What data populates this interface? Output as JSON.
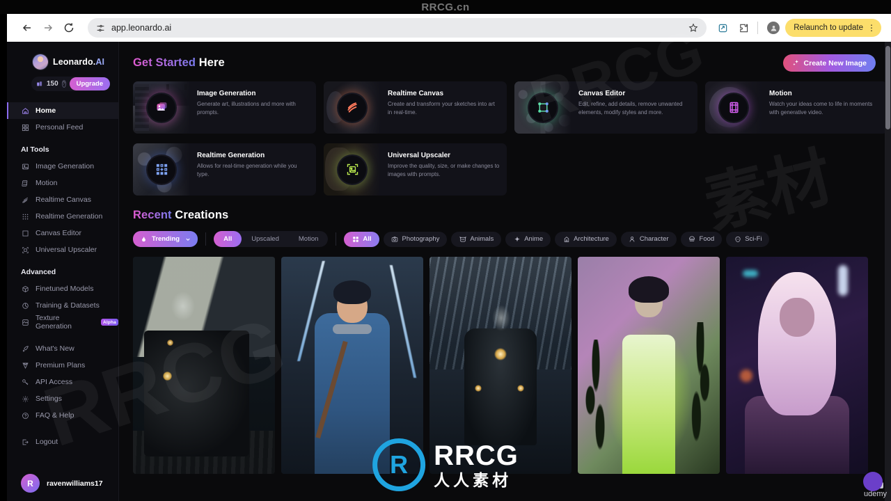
{
  "browser": {
    "url": "app.leonardo.ai",
    "back_icon": "back-arrow-icon",
    "forward_icon": "forward-arrow-icon",
    "reload_icon": "reload-icon",
    "site_settings_icon": "tune-icon",
    "bookmark_icon": "star-icon",
    "share_icon": "share-icon",
    "extensions_icon": "puzzle-icon",
    "profile_label": "",
    "relaunch_label": "Relaunch to update",
    "menu_icon": "kebab-menu-icon"
  },
  "watermarks": {
    "top": "RRCG.cn",
    "center_title": "RRCG",
    "center_sub": "人人素材",
    "center_mark": "R",
    "udemy": "udemy",
    "ghost1": "RRCG",
    "ghost2": "RRCG",
    "ghost_cn": "素材"
  },
  "sidebar": {
    "brand": {
      "name": "Leonardo.",
      "suffix": "AI",
      "logo_icon": "leonardo-avatar-icon"
    },
    "credits": {
      "icon": "token-icon",
      "amount": "150",
      "help_icon": "question-mark-icon",
      "upgrade_label": "Upgrade"
    },
    "nav_top": [
      {
        "label": "Home",
        "icon": "home-icon",
        "active": true
      },
      {
        "label": "Personal Feed",
        "icon": "grid-icon",
        "active": false
      }
    ],
    "section_ai_tools": "AI Tools",
    "ai_tools": [
      {
        "label": "Image Generation",
        "icon": "image-icon"
      },
      {
        "label": "Motion",
        "icon": "motion-icon"
      },
      {
        "label": "Realtime Canvas",
        "icon": "brush-icon"
      },
      {
        "label": "Realtime Generation",
        "icon": "dots-grid-icon"
      },
      {
        "label": "Canvas Editor",
        "icon": "crop-frame-icon"
      },
      {
        "label": "Universal Upscaler",
        "icon": "upscale-icon"
      }
    ],
    "section_advanced": "Advanced",
    "advanced": [
      {
        "label": "Finetuned Models",
        "icon": "cube-icon",
        "badge": ""
      },
      {
        "label": "Training & Datasets",
        "icon": "dataset-icon",
        "badge": ""
      },
      {
        "label": "Texture Generation",
        "icon": "texture-icon",
        "badge": "Alpha"
      }
    ],
    "misc": [
      {
        "label": "What's New",
        "icon": "rocket-icon"
      },
      {
        "label": "Premium Plans",
        "icon": "gem-icon"
      },
      {
        "label": "API Access",
        "icon": "key-icon"
      },
      {
        "label": "Settings",
        "icon": "gear-icon"
      },
      {
        "label": "FAQ & Help",
        "icon": "help-circle-icon"
      }
    ],
    "logout": {
      "label": "Logout",
      "icon": "logout-icon"
    },
    "user": {
      "initial": "R",
      "name": "ravenwilliams17"
    }
  },
  "main": {
    "get_started": {
      "accent": "Get Started",
      "rest": " Here"
    },
    "create_button": {
      "label": "Create New Image",
      "icon": "sparkle-icon"
    },
    "cards": [
      {
        "title": "Image Generation",
        "desc": "Generate art, illustrations and more with prompts.",
        "icon": "image-gen-icon"
      },
      {
        "title": "Realtime Canvas",
        "desc": "Create and transform your sketches into art in real-time.",
        "icon": "realtime-canvas-icon"
      },
      {
        "title": "Canvas Editor",
        "desc": "Edit, refine, add details, remove unwanted elements, modify styles and more.",
        "icon": "canvas-editor-icon"
      },
      {
        "title": "Motion",
        "desc": "Watch your ideas come to life in moments with generative video.",
        "icon": "motion-film-icon"
      },
      {
        "title": "Realtime Generation",
        "desc": "Allows for real-time generation while you type.",
        "icon": "realtime-gen-icon"
      },
      {
        "title": "Universal Upscaler",
        "desc": "Improve the quality, size, or make changes to images with prompts.",
        "icon": "upscaler-icon"
      }
    ],
    "recent": {
      "accent": "Recent",
      "rest": " Creations"
    },
    "trending": {
      "label": "Trending",
      "icon": "flame-icon",
      "chevron": "chevron-down-icon"
    },
    "segments": [
      {
        "label": "All",
        "active": true
      },
      {
        "label": "Upscaled",
        "active": false
      },
      {
        "label": "Motion",
        "active": false
      }
    ],
    "categories": [
      {
        "label": "All",
        "icon": "grid-squares-icon",
        "active": true
      },
      {
        "label": "Photography",
        "icon": "camera-icon",
        "active": false
      },
      {
        "label": "Animals",
        "icon": "paw-icon",
        "active": false
      },
      {
        "label": "Anime",
        "icon": "sparkle-small-icon",
        "active": false
      },
      {
        "label": "Architecture",
        "icon": "building-icon",
        "active": false
      },
      {
        "label": "Character",
        "icon": "person-icon",
        "active": false
      },
      {
        "label": "Food",
        "icon": "burger-icon",
        "active": false
      },
      {
        "label": "Sci-Fi",
        "icon": "alien-icon",
        "active": false
      }
    ],
    "gallery": [
      {
        "alt": "steam locomotive in station hall"
      },
      {
        "alt": "anime boy with lightning background"
      },
      {
        "alt": "steam locomotive head-on in station"
      },
      {
        "alt": "woman in glowing green dress with plants"
      },
      {
        "alt": "woman with white hair in neon city"
      }
    ]
  }
}
